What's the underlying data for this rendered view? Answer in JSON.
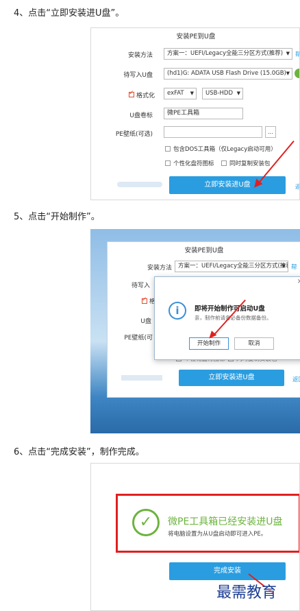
{
  "steps": [
    {
      "label": "4、点击“立即安装进U盘”。",
      "window_title": "安装PE到U盘",
      "method_label": "安装方法",
      "method_value": "方案一：UEFI/Legacy全能三分区方式(推荐)",
      "method_side": "帮",
      "target_label": "待写入U盘",
      "target_value": "(hd1)G: ADATA USB Flash Drive (15.0GB)",
      "format_label": "格式化",
      "fs_value": "exFAT",
      "mode_value": "USB-HDD",
      "volume_label": "U盘卷标",
      "volume_value": "微PE工具箱",
      "wallpaper_label": "PE壁纸(可选)",
      "browse_label": "...",
      "dos_option": "包含DOS工具箱（仅Legacy启动可用）",
      "icon_option": "个性化盘符图标",
      "copy_option": "同时复制安装包",
      "install_button": "立即安装进U盘",
      "return_label": "返"
    },
    {
      "label": "5、点击“开始制作”。",
      "window_title": "安装PE到U盘",
      "method_label": "安装方法",
      "method_value": "方案一：UEFI/Legacy全能三分区方式(推荐)",
      "method_side": "帮",
      "target_label": "待写入",
      "format_label": "格",
      "volume_label": "U盘",
      "wallpaper_label": "PE壁纸(可",
      "icon_option": "个性化盘符图标",
      "copy_option": "同时复制安装包",
      "install_button": "立即安装进U盘",
      "return_label": "返回",
      "dialog_title": "即将开始制作可启动U盘",
      "dialog_message": "亲，制作前请务必备份数据备份。",
      "dialog_close": "×",
      "dialog_start": "开始制作",
      "dialog_cancel": "取消"
    },
    {
      "label": "6、点击“完成安装”，制作完成。",
      "done_title": "微PE工具箱已经安装进U盘",
      "done_subtitle": "将电脑设置为从U盘启动即可进入PE。",
      "finish_button": "完成安装"
    }
  ],
  "watermark": "最需教育",
  "colors": {
    "accent_blue": "#2a9de0",
    "success_green": "#6cb33e",
    "highlight_red": "#e02020"
  }
}
